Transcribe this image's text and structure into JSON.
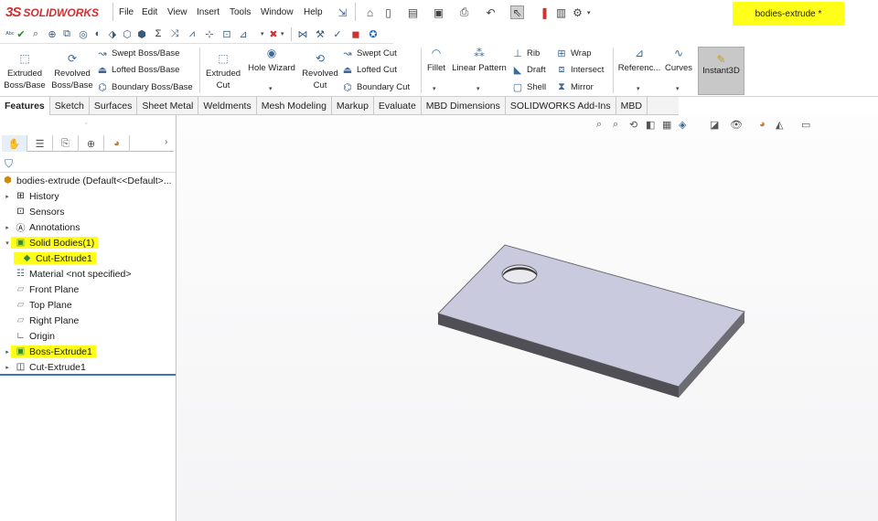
{
  "app": {
    "brand": "SOLIDWORKS",
    "document_title": "bodies-extrude *"
  },
  "menu": [
    "File",
    "Edit",
    "View",
    "Insert",
    "Tools",
    "Window",
    "Help"
  ],
  "ribbon": {
    "extruded_boss": "Extruded Boss/Base",
    "revolved_boss": "Revolved Boss/Base",
    "swept_boss": "Swept Boss/Base",
    "lofted_boss": "Lofted Boss/Base",
    "boundary_boss": "Boundary Boss/Base",
    "extruded_cut": "Extruded Cut",
    "hole_wizard": "Hole Wizard",
    "revolved_cut": "Revolved Cut",
    "swept_cut": "Swept Cut",
    "lofted_cut": "Lofted Cut",
    "boundary_cut": "Boundary Cut",
    "fillet": "Fillet",
    "linear_pattern": "Linear Pattern",
    "rib": "Rib",
    "draft": "Draft",
    "shell": "Shell",
    "wrap": "Wrap",
    "intersect": "Intersect",
    "mirror": "Mirror",
    "reference": "Referenc...",
    "curves": "Curves",
    "instant3d": "Instant3D"
  },
  "tabs": [
    "Features",
    "Sketch",
    "Surfaces",
    "Sheet Metal",
    "Weldments",
    "Mesh Modeling",
    "Markup",
    "Evaluate",
    "MBD Dimensions",
    "SOLIDWORKS Add-Ins",
    "MBD"
  ],
  "tree": {
    "root": "bodies-extrude  (Default<<Default>...",
    "items": [
      {
        "label": "History"
      },
      {
        "label": "Sensors"
      },
      {
        "label": "Annotations"
      },
      {
        "label": "Solid Bodies(1)"
      },
      {
        "label": "Cut-Extrude1"
      },
      {
        "label": "Material <not specified>"
      },
      {
        "label": "Front Plane"
      },
      {
        "label": "Top Plane"
      },
      {
        "label": "Right Plane"
      },
      {
        "label": "Origin"
      },
      {
        "label": "Boss-Extrude1"
      },
      {
        "label": "Cut-Extrude1"
      }
    ]
  },
  "colors": {
    "highlight": "#ffff1a",
    "brand": "#d0302f",
    "part_top": "#c9cade",
    "part_side": "#5a5a60"
  }
}
